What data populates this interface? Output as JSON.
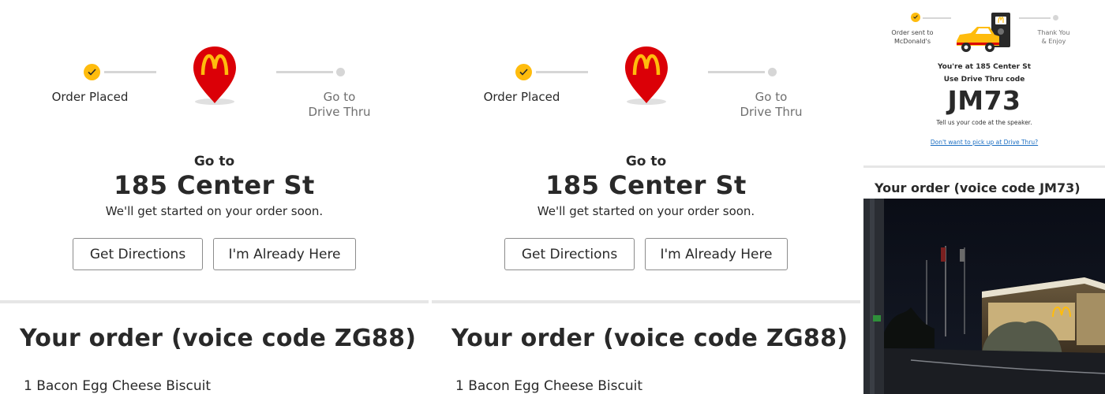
{
  "panels": [
    {
      "tracker": {
        "left_label": "Order Placed",
        "right_label_line1": "Go to",
        "right_label_line2": "Drive Thru"
      },
      "go_to": "Go to",
      "address": "185 Center St",
      "subtext": "We'll get started on your order soon.",
      "buttons": {
        "directions": "Get Directions",
        "already_here": "I'm Already Here"
      },
      "order_title": "Your order (voice code ZG88)",
      "order_items": [
        "1 Bacon Egg Cheese Biscuit"
      ]
    },
    {
      "tracker": {
        "left_label": "Order Placed",
        "right_label_line1": "Go to",
        "right_label_line2": "Drive Thru"
      },
      "go_to": "Go to",
      "address": "185 Center St",
      "subtext": "We'll get started on your order soon.",
      "buttons": {
        "directions": "Get Directions",
        "already_here": "I'm Already Here"
      },
      "order_title": "Your order (voice code ZG88)",
      "order_items": [
        "1 Bacon Egg Cheese Biscuit"
      ]
    }
  ],
  "panel3": {
    "tracker": {
      "left_line1": "Order sent to",
      "left_line2": "McDonald's",
      "right_line1": "Thank You",
      "right_line2": "& Enjoy"
    },
    "at_location": "You're at 185 Center St",
    "instruction": "Use Drive Thru code",
    "code": "JM73",
    "tell": "Tell us your code at the speaker.",
    "link": "Don't want to pick up at Drive Thru?",
    "order_title": "Your order (voice code JM73)"
  },
  "colors": {
    "brand_red": "#db0007",
    "brand_yellow": "#ffbc0d",
    "link_blue": "#1b6ec2"
  },
  "icons": [
    "check-icon",
    "mcdonalds-location-pin-icon",
    "car-at-drive-thru-icon"
  ]
}
